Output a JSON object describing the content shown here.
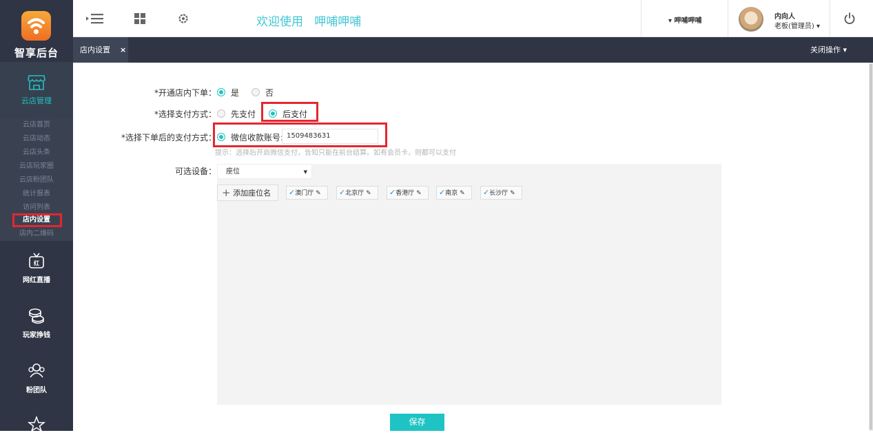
{
  "brand": {
    "name": "智享后台"
  },
  "sidebar": {
    "main": {
      "label": "云店管理"
    },
    "subitems": [
      "云店首页",
      "云店动态",
      "云店头条",
      "云店玩家圈",
      "云店粉团队",
      "统计报表",
      "访问列表",
      "店内设置",
      "店内二维码"
    ],
    "selected_index": 7,
    "blocks": [
      {
        "label": "网红直播",
        "icon": "tv-icon"
      },
      {
        "label": "玩家挣钱",
        "icon": "coins-icon"
      },
      {
        "label": "粉团队",
        "icon": "team-icon"
      }
    ]
  },
  "topbar": {
    "welcome": "欢迎使用   呷哺呷哺",
    "shop_selector": "▾ 呷哺呷哺",
    "user_name": "内向人",
    "user_role": "老板(管理员) ▾"
  },
  "tabs": {
    "active_label": "店内设置",
    "close_glyph": "×",
    "close_ops": "关闭操作 ▾"
  },
  "form": {
    "in_store_order": {
      "label": "*开通店内下单：",
      "options": [
        "是",
        "否"
      ],
      "selected": "是"
    },
    "payment_method": {
      "label": "*选择支付方式：",
      "options": [
        "先支付",
        "后支付"
      ],
      "selected": "后支付"
    },
    "post_order_payment": {
      "label": "*选择下单后的支付方式：",
      "option": "微信收款账号:",
      "account_value": "1509483631"
    },
    "hint": "提示：选择后开启微信支付，告知只能在前台结算。如有会员卡，则都可以支付",
    "devices": {
      "label": "可选设备：",
      "select_value": "座位",
      "add_button": "添加座位名",
      "seats": [
        "澳门厅",
        "北京厅",
        "香港厅",
        "南京",
        "长沙厅"
      ]
    },
    "save_label": "保存"
  },
  "colors": {
    "accent": "#1fc3c3",
    "sidebar_bg": "#2f3544",
    "highlight": "#e5262f",
    "welcome": "#41c7d4"
  }
}
